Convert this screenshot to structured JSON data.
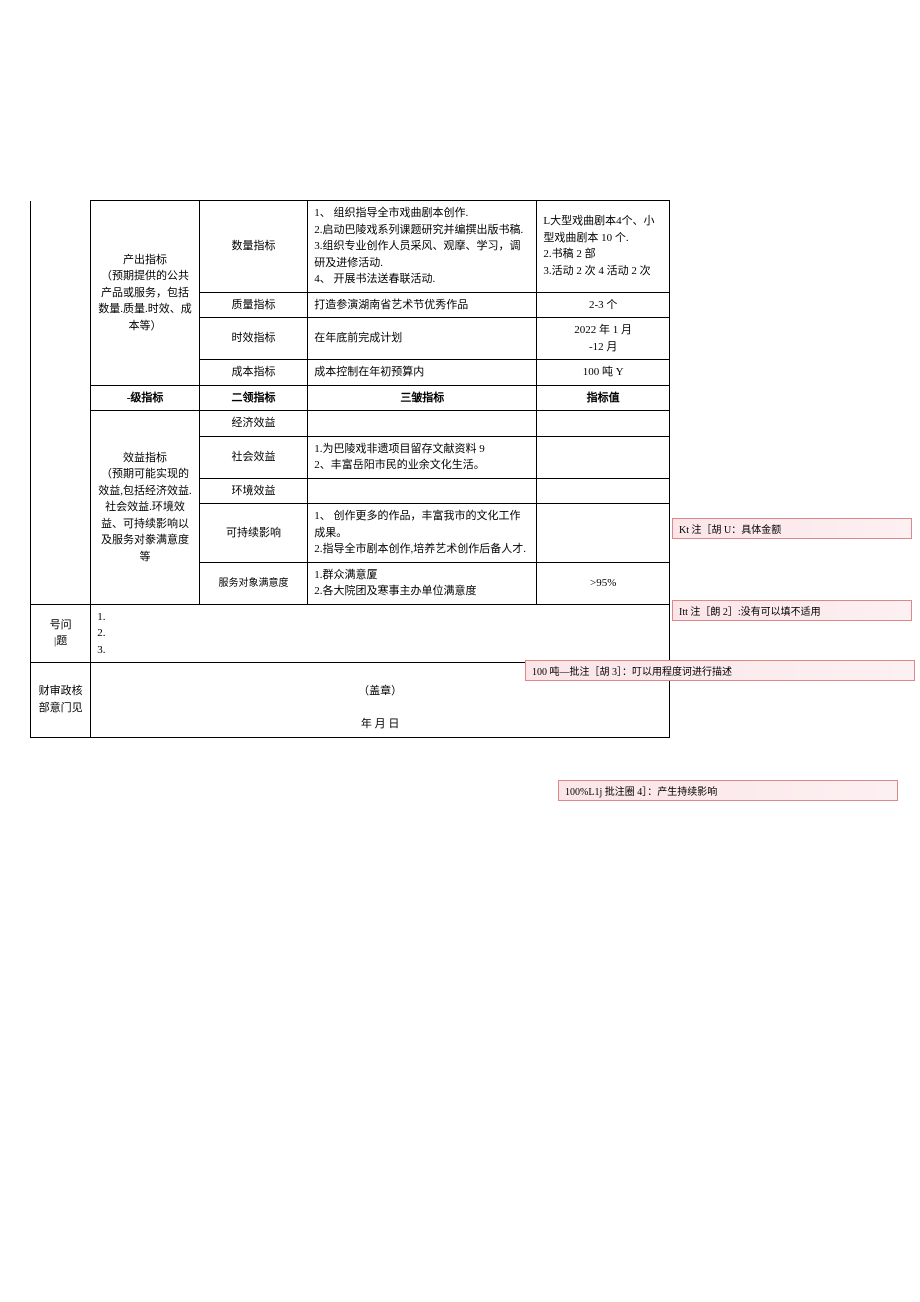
{
  "output_indicator": {
    "label": "产出指标\n（预期提供的公共产品或服务，包括数量.质量.时效、成本等）",
    "rows": [
      {
        "l2": "数量指标",
        "l3": "1、 组织指导全市戏曲剧本创作.\n2.启动巴陵戏系列课题研究并编撰出版书稿.\n3.组织专业创作人员采风、观摩、学习，调研及进修活动.\n4、 开展书法送春联活动.",
        "value": "L大型戏曲剧本4个、小型戏曲剧本 10 个.\n2.书稿 2 部\n3.活动 2 次 4 活动 2 次"
      },
      {
        "l2": "质量指标",
        "l3": "打造参演湖南省艺术节优秀作品",
        "value": "2-3 个"
      },
      {
        "l2": "时效指标",
        "l3": "在年底前完成计划",
        "value": "2022 年 1 月\n-12 月"
      },
      {
        "l2": "成本指标",
        "l3": "成本控制在年初预算内",
        "value": "100 吨 Y"
      }
    ]
  },
  "header2": {
    "c1": "-级指标",
    "c2": "二领指标",
    "c3": "三皱指标",
    "c4": "指标值"
  },
  "benefit_indicator": {
    "label": "效益指标\n（预期可能实现的效益,包括经济效益.社会效益.环境效益、可持续影响以及服务对豢满意度等",
    "rows": [
      {
        "l2": "经济效益",
        "l3": "",
        "value": ""
      },
      {
        "l2": "社会效益",
        "l3": "1.为巴陵戏非遗项目留存文献资料 9\n2、丰富岳阳市民的业余文化生活。",
        "value": "100 吨—批注［胡 3］：叮以用程度诃进行描述"
      },
      {
        "l2": "环境效益",
        "l3": "",
        "value": ""
      },
      {
        "l2": "可持续影响",
        "l3": "1、 创作更多的作品，丰富我市的文化工作成果。\n2.指导全市剧本创作,培养艺术创作后备人才.",
        "value": "100%L1j 批注圈 4］：产生持续影响"
      },
      {
        "l2": "服务对象满意度",
        "l3": "1.群众满意厦\n2.各大院团及寒事主办单位满意度",
        "value": ">95%"
      }
    ]
  },
  "issues": {
    "label": "号问\n|题",
    "content": "1.\n2.\n3."
  },
  "finance": {
    "label": "财审政核\n部意门见",
    "content": "（盖章）\n\n年       月       日"
  },
  "comments": {
    "c1": "Kt 注［胡 U：具体金额",
    "c2": "Itt 注［朗 2］:没有可以填不适用",
    "c3": "100 吨—批注［胡 3］：叮以用程度诃进行描述",
    "c4": "100%L1j 批注圈 4］：产生持续影响"
  }
}
